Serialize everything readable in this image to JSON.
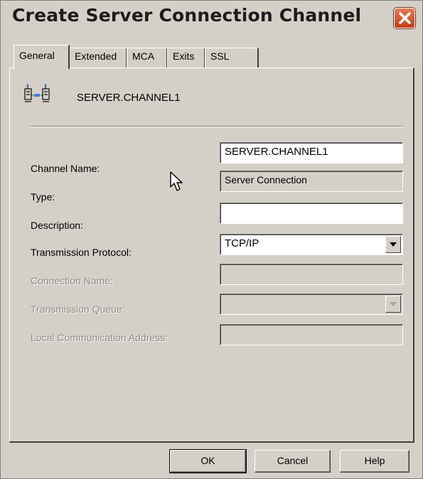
{
  "window": {
    "title": "Create Server Connection Channel"
  },
  "tabs": [
    {
      "label": "General",
      "active": true
    },
    {
      "label": "Extended",
      "active": false
    },
    {
      "label": "MCA",
      "active": false
    },
    {
      "label": "Exits",
      "active": false
    },
    {
      "label": "SSL",
      "active": false
    }
  ],
  "header": {
    "icon": "channel-icon",
    "name": "SERVER.CHANNEL1"
  },
  "fields": {
    "channel_name": {
      "label": "Channel Name:",
      "value": "SERVER.CHANNEL1"
    },
    "type": {
      "label": "Type:",
      "value": "Server Connection"
    },
    "description": {
      "label": "Description:",
      "value": ""
    },
    "transmission_protocol": {
      "label": "Transmission Protocol:",
      "value": "TCP/IP"
    },
    "connection_name": {
      "label": "Connection Name:",
      "value": ""
    },
    "transmission_queue": {
      "label": "Transmission Queue:",
      "value": ""
    },
    "local_communication_address": {
      "label": "Local Communication Address:",
      "value": ""
    }
  },
  "buttons": {
    "ok": "OK",
    "cancel": "Cancel",
    "help": "Help"
  },
  "colors": {
    "dialog_bg": "#d4d0c8",
    "close_button": "#d9532c",
    "disabled_text": "#8d8c88"
  }
}
